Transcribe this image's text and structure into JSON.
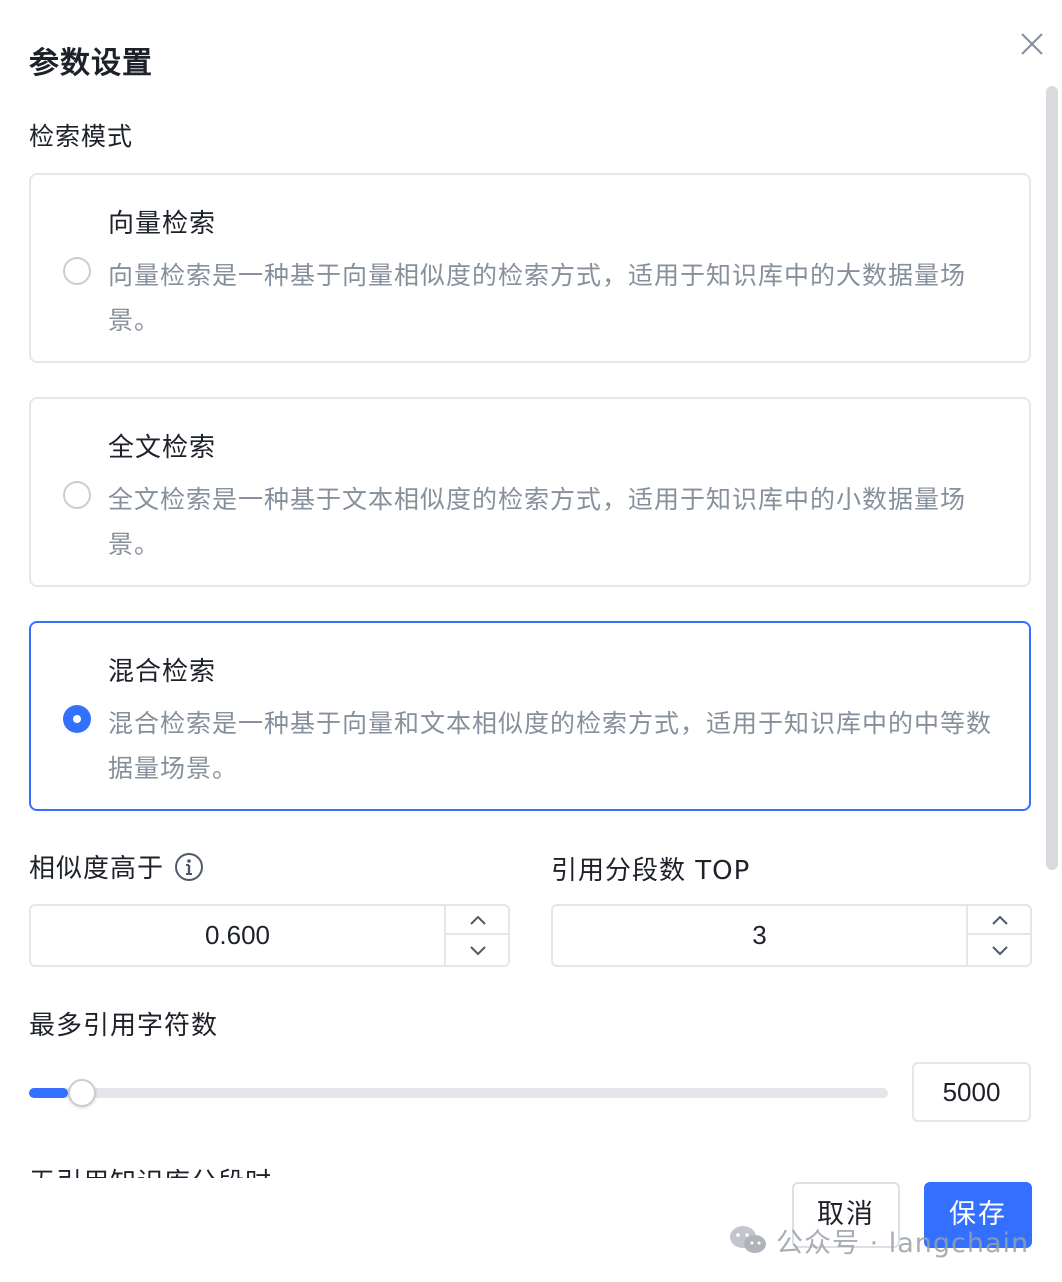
{
  "dialog": {
    "title": "参数设置",
    "close_icon": "close-icon"
  },
  "search_mode": {
    "label": "检索模式",
    "options": [
      {
        "name": "向量检索",
        "description": "向量检索是一种基于向量相似度的检索方式，适用于知识库中的大数据量场景。",
        "selected": false
      },
      {
        "name": "全文检索",
        "description": "全文检索是一种基于文本相似度的检索方式，适用于知识库中的小数据量场景。",
        "selected": false
      },
      {
        "name": "混合检索",
        "description": "混合检索是一种基于向量和文本相似度的检索方式，适用于知识库中的中等数据量场景。",
        "selected": true
      }
    ]
  },
  "similarity": {
    "label": "相似度高于",
    "info_icon": "info-icon",
    "value": "0.600"
  },
  "top_k": {
    "label": "引用分段数 TOP",
    "value": "3"
  },
  "max_chars": {
    "label": "最多引用字符数",
    "value": "5000",
    "slider_fraction": 0.045
  },
  "no_reference": {
    "label": "无引用知识库分段时"
  },
  "footer": {
    "cancel_label": "取消",
    "save_label": "保存"
  },
  "watermark": {
    "text": "公众号 · langchain"
  },
  "colors": {
    "accent": "#3370ff",
    "border": "#e5e6eb",
    "muted_text": "#86909c"
  }
}
